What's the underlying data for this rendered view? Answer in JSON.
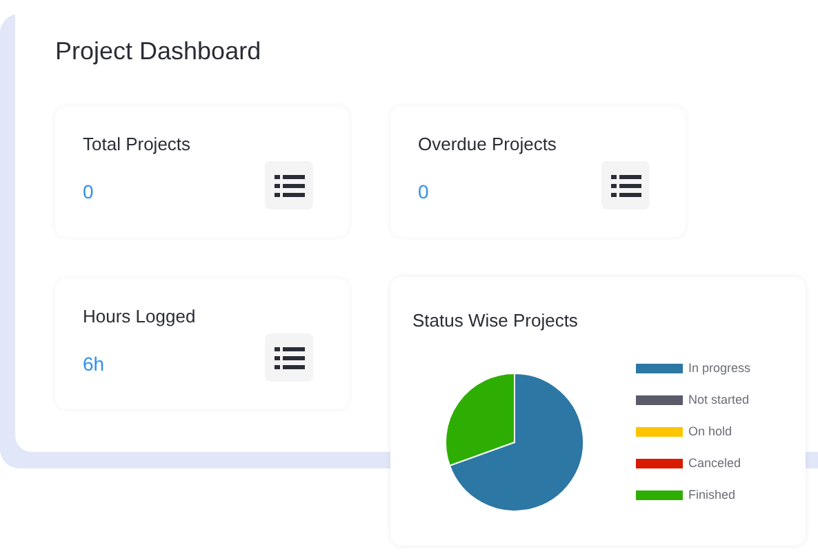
{
  "title": "Project Dashboard",
  "stats": [
    {
      "label": "Total Projects",
      "value": "0"
    },
    {
      "label": "Overdue Projects",
      "value": "0"
    },
    {
      "label": "Hours Logged",
      "value": "6h"
    }
  ],
  "status_chart": {
    "title": "Status Wise Projects",
    "legend": [
      {
        "label": "In progress",
        "color": "#2c77a4"
      },
      {
        "label": "Not started",
        "color": "#5a5b68"
      },
      {
        "label": "On hold",
        "color": "#fcc500"
      },
      {
        "label": "Canceled",
        "color": "#d91a00"
      },
      {
        "label": "Finished",
        "color": "#2eae02"
      }
    ]
  }
}
